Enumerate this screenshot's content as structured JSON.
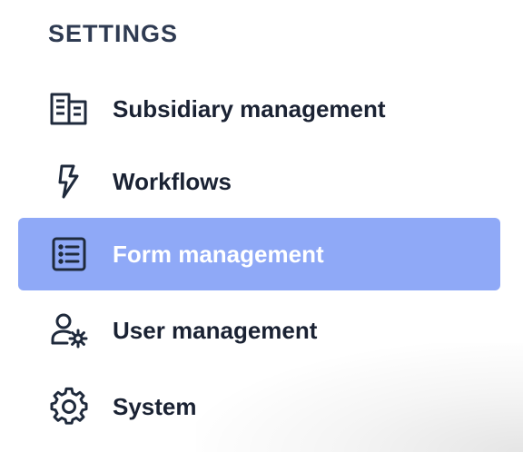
{
  "settings": {
    "title": "SETTINGS",
    "items": [
      {
        "label": "Subsidiary management",
        "icon": "building-icon",
        "active": false
      },
      {
        "label": "Workflows",
        "icon": "lightning-bolt-icon",
        "active": false
      },
      {
        "label": "Form management",
        "icon": "list-form-icon",
        "active": true
      },
      {
        "label": "User management",
        "icon": "user-gear-icon",
        "active": false
      },
      {
        "label": "System",
        "icon": "gear-icon",
        "active": false
      }
    ]
  },
  "colors": {
    "active_background": "#8fa9f7",
    "title_text": "#2f3b52",
    "item_text": "#1a2233",
    "icon_stroke": "#1f2a3c",
    "active_text": "#ffffff"
  }
}
